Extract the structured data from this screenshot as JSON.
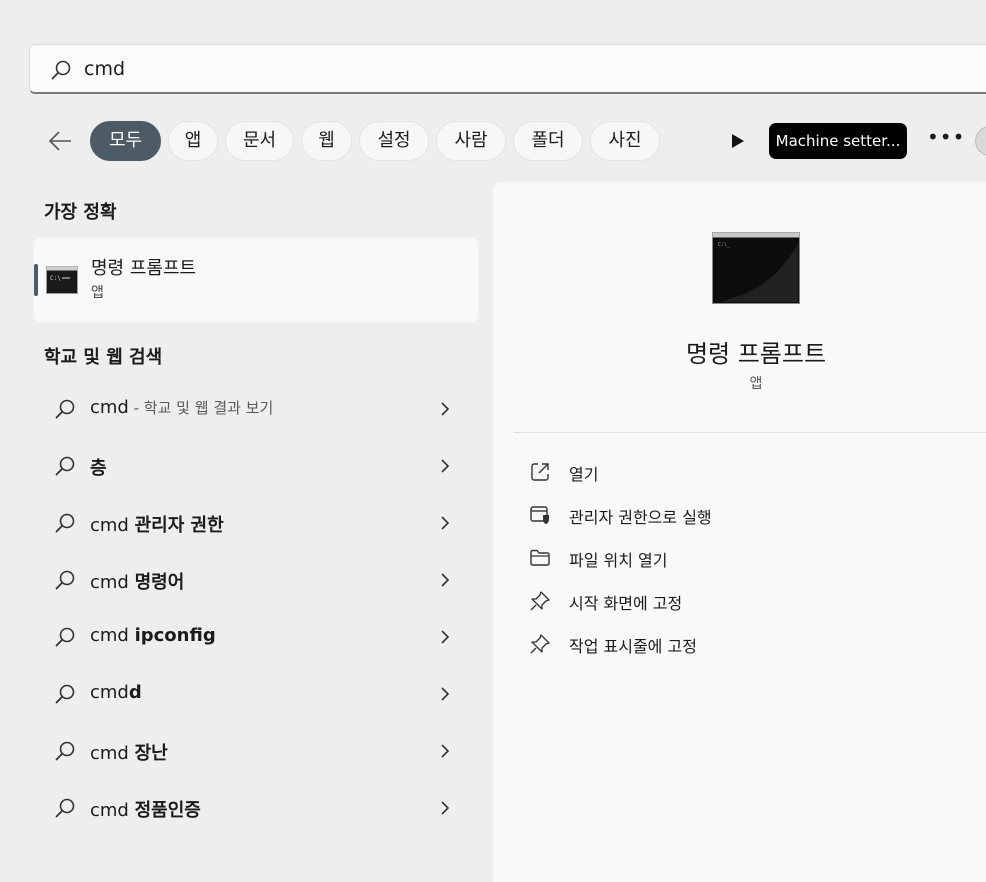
{
  "search": {
    "query": "cmd"
  },
  "filters": {
    "back_icon": "back-arrow-icon",
    "chips": [
      "모두",
      "앱",
      "문서",
      "웹",
      "설정",
      "사람",
      "폴더",
      "사진"
    ],
    "active_chip": "모두",
    "play_icon": "play-icon",
    "machine_chip": "Machine setter...",
    "more_label": "•••"
  },
  "best_match": {
    "section_title": "가장 정확",
    "name": "명령 프롬프트",
    "type": "앱",
    "icon": "command-prompt-icon"
  },
  "web_search": {
    "section_title": "학교 및 웹 검색",
    "items": [
      {
        "query": "cmd",
        "suffix": "",
        "detail": " - 학교 및 웹 결과 보기"
      },
      {
        "query": "",
        "suffix": "층",
        "detail": ""
      },
      {
        "query": "cmd ",
        "suffix": "관리자 권한",
        "detail": ""
      },
      {
        "query": "cmd ",
        "suffix": "명령어",
        "detail": ""
      },
      {
        "query": "cmd ",
        "suffix": "ipconfig",
        "detail": ""
      },
      {
        "query": "cmd",
        "suffix": "d",
        "detail": ""
      },
      {
        "query": "cmd ",
        "suffix": "장난",
        "detail": ""
      },
      {
        "query": "cmd ",
        "suffix": "정품인증",
        "detail": ""
      }
    ]
  },
  "preview": {
    "name": "명령 프롬프트",
    "type": "앱",
    "actions": [
      {
        "label": "열기",
        "icon": "open-external-icon"
      },
      {
        "label": "관리자 권한으로 실행",
        "icon": "admin-shield-icon"
      },
      {
        "label": "파일 위치 열기",
        "icon": "folder-icon"
      },
      {
        "label": "시작 화면에 고정",
        "icon": "pin-icon"
      },
      {
        "label": "작업 표시줄에 고정",
        "icon": "pin-icon"
      }
    ]
  },
  "colors": {
    "accent": "#4d5b66",
    "background": "#eeeeee",
    "panel": "#f9f9f9"
  }
}
